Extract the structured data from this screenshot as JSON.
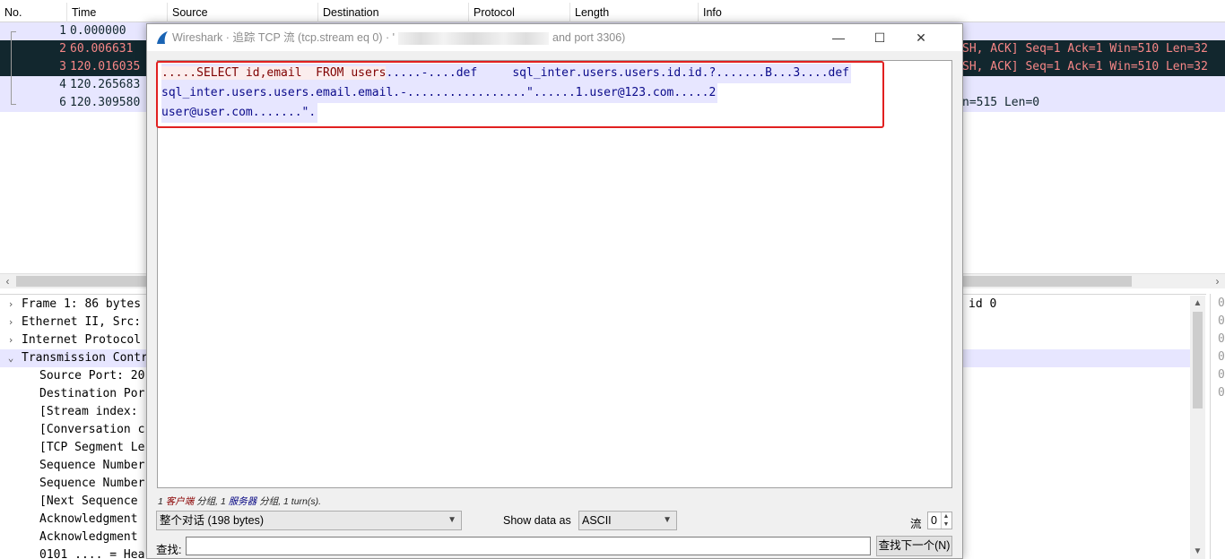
{
  "packet_list": {
    "columns": [
      "No.",
      "Time",
      "Source",
      "Destination",
      "Protocol",
      "Length",
      "Info"
    ],
    "rows": [
      {
        "no": "1",
        "time": "0.000000",
        "info": "",
        "style": "light"
      },
      {
        "no": "2",
        "time": "60.006631",
        "info": "SH, ACK] Seq=1 Ack=1 Win=510 Len=32",
        "style": "dark"
      },
      {
        "no": "3",
        "time": "120.016035",
        "info": "SH, ACK] Seq=1 Ack=1 Win=510 Len=32",
        "style": "dark"
      },
      {
        "no": "4",
        "time": "120.265683",
        "info": "",
        "style": "light"
      },
      {
        "no": "6",
        "time": "120.309580",
        "info": "n=515 Len=0",
        "style": "light"
      }
    ]
  },
  "details": {
    "rows": [
      {
        "chev": "›",
        "text": "Frame 1: 86 bytes",
        "right": "id 0"
      },
      {
        "chev": "›",
        "text": "Ethernet II, Src:"
      },
      {
        "chev": "›",
        "text": "Internet Protocol"
      },
      {
        "chev": "⌄",
        "text": "Transmission Contr",
        "selected": true
      },
      {
        "text": "Source Port: 20"
      },
      {
        "text": "Destination Por"
      },
      {
        "text": "[Stream index:"
      },
      {
        "text": "[Conversation c"
      },
      {
        "text": "[TCP Segment Le"
      },
      {
        "text": "Sequence Number"
      },
      {
        "text": "Sequence Number"
      },
      {
        "text": "[Next Sequence"
      },
      {
        "text": "Acknowledgment"
      },
      {
        "text": "Acknowledgment"
      },
      {
        "text": "0101 .... = Hea"
      }
    ],
    "bytes_column": [
      "0",
      "0",
      "0",
      "0",
      "0",
      "0"
    ]
  },
  "dialog": {
    "title_prefix": "Wireshark · 追踪 TCP 流 (tcp.stream eq 0) · '",
    "title_suffix": "and port 3306)",
    "window_buttons": {
      "minimize": "—",
      "maximize": "☐",
      "close": "✕"
    },
    "stream_lines": [
      {
        "client": ".....SELECT id,email  FROM users",
        "server": ".....-....def     sql_inter.users.users.id.id.?.......B...3....def"
      },
      {
        "client": "",
        "server": "sql_inter.users.users.email.email.-.................\"......1.user@123.com.....2"
      },
      {
        "client": "",
        "server": "user@user.com.......\"."
      }
    ],
    "summary": {
      "part1": "1 ",
      "client_label": "客户端",
      "part2": " 分组, 1 ",
      "server_label": "服务器",
      "part3": " 分组, 1 turn(s)."
    },
    "conversation_select": "整个对话 (198 bytes)",
    "show_data_label": "Show data as",
    "show_data_value": "ASCII",
    "stream_label": "流",
    "stream_value": "0",
    "find_label": "查找:",
    "find_value": "",
    "find_next_label": "查找下一个(N)"
  },
  "colors": {
    "client_text": "#7f0000",
    "client_bg": "#fbeded",
    "server_text": "#0a0a8a",
    "server_bg": "#e7e6ff",
    "highlight": "#e12020",
    "row_dark_bg": "#12272e",
    "row_dark_fg": "#f78787"
  },
  "icons": {
    "app": "wireshark-fin-icon",
    "combo": "chevron-down-icon"
  }
}
